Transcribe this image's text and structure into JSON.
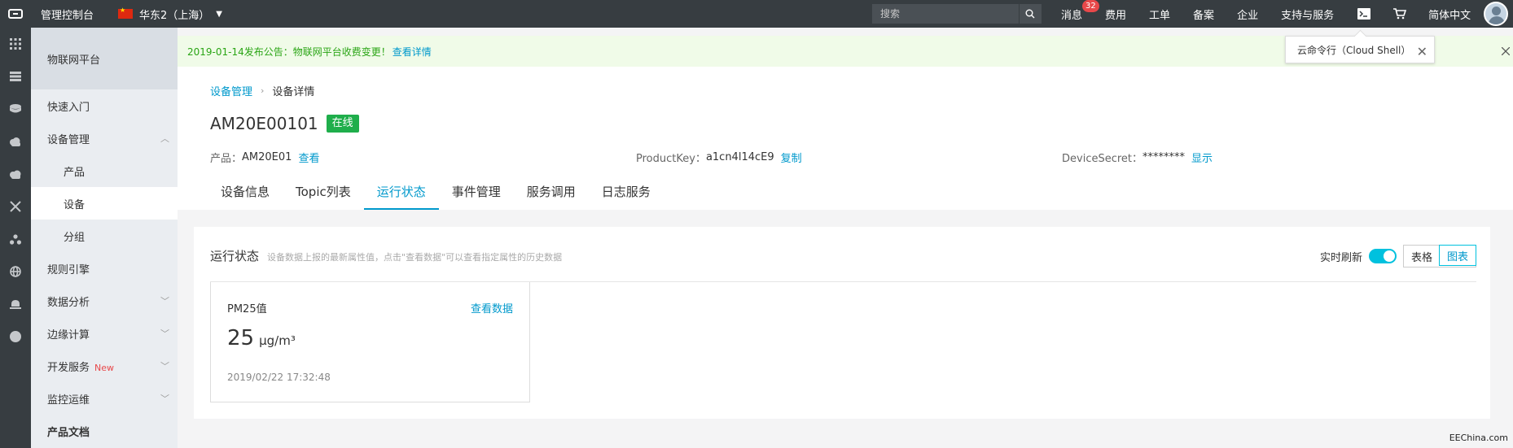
{
  "topbar": {
    "console_title": "管理控制台",
    "region": "华东2（上海）",
    "search_placeholder": "搜索",
    "nav": [
      {
        "label": "消息",
        "badge": "32"
      },
      {
        "label": "费用"
      },
      {
        "label": "工单"
      },
      {
        "label": "备案"
      },
      {
        "label": "企业"
      },
      {
        "label": "支持与服务"
      }
    ],
    "language": "简体中文",
    "icons": [
      "terminal-icon",
      "cart-icon"
    ]
  },
  "rail_icons": [
    "grid-icon",
    "server-icon",
    "database-icon",
    "cloud-icon",
    "cloud-storage-icon",
    "network-icon",
    "cluster-icon",
    "globe-icon",
    "monitor-icon",
    "dot-icon"
  ],
  "sidebar": {
    "title": "物联网平台",
    "items": [
      {
        "label": "快速入门",
        "type": "item"
      },
      {
        "label": "设备管理",
        "type": "group",
        "chevron": "up"
      },
      {
        "label": "产品",
        "type": "sub"
      },
      {
        "label": "设备",
        "type": "sub",
        "active": true
      },
      {
        "label": "分组",
        "type": "sub"
      },
      {
        "label": "规则引擎",
        "type": "item"
      },
      {
        "label": "数据分析",
        "type": "group",
        "chevron": "down"
      },
      {
        "label": "边缘计算",
        "type": "group",
        "chevron": "down"
      },
      {
        "label": "开发服务",
        "type": "group",
        "chevron": "down",
        "tag": "New"
      },
      {
        "label": "监控运维",
        "type": "group",
        "chevron": "down"
      },
      {
        "label": "产品文档",
        "type": "item",
        "bold": true
      }
    ]
  },
  "notice": {
    "text": "2019-01-14发布公告：物联网平台收费变更！",
    "link": "查看详情"
  },
  "tooltip": {
    "text": "云命令行（Cloud Shell）"
  },
  "breadcrumb": {
    "parent": "设备管理",
    "current": "设备详情"
  },
  "device": {
    "name": "AM20E00101",
    "status": "在线",
    "product_label": "产品：",
    "product_value": "AM20E01",
    "product_link": "查看",
    "key_label": "ProductKey：",
    "key_value": "a1cn4l14cE9",
    "key_link": "复制",
    "secret_label": "DeviceSecret：",
    "secret_value": "********",
    "secret_link": "显示"
  },
  "tabs": [
    {
      "label": "设备信息"
    },
    {
      "label": "Topic列表"
    },
    {
      "label": "运行状态",
      "active": true
    },
    {
      "label": "事件管理"
    },
    {
      "label": "服务调用"
    },
    {
      "label": "日志服务"
    }
  ],
  "panel": {
    "title": "运行状态",
    "desc": "设备数据上报的最新属性值，点击\"查看数据\"可以查看指定属性的历史数据",
    "switch_label": "实时刷新",
    "switch_on": true,
    "view_table": "表格",
    "view_chart": "图表",
    "selected_view": "图表"
  },
  "property": {
    "name": "PM25值",
    "link": "查看数据",
    "value": "25",
    "unit": "μg/m³",
    "time": "2019/02/22 17:32:48"
  },
  "watermark": "EEChina.com",
  "colors": {
    "topbar": "#373d41",
    "accent": "#0099cc",
    "online": "#1fae4b",
    "switch": "#00c1de",
    "notice_bg": "#f0fbe8",
    "notice_text": "#2aa515",
    "badge": "#e8484a"
  }
}
